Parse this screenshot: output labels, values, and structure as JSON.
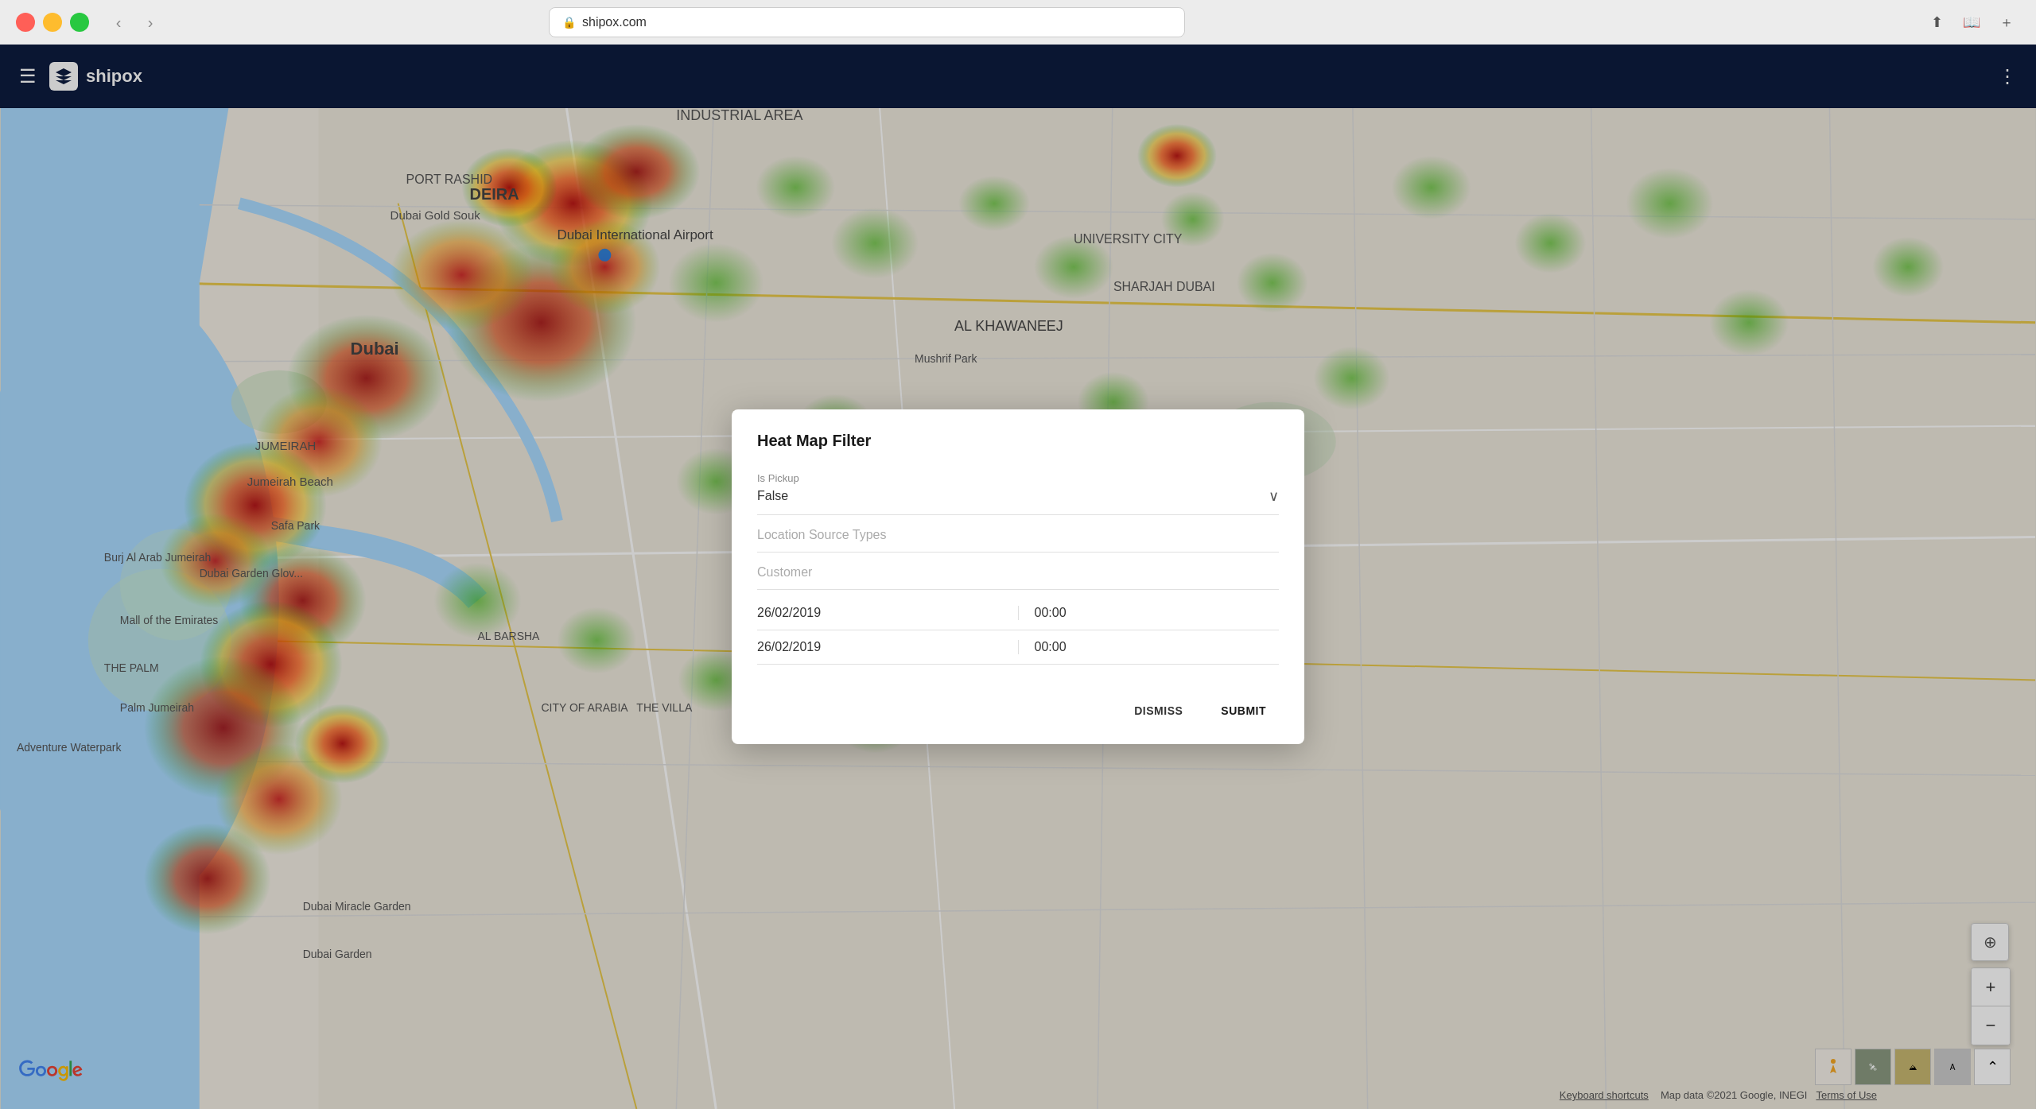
{
  "browser": {
    "url": "shipox.com",
    "back_label": "‹",
    "forward_label": "›"
  },
  "app": {
    "name": "shipox",
    "logo_alt": "Shipox logo"
  },
  "modal": {
    "title": "Heat Map Filter",
    "fields": {
      "is_pickup": {
        "label": "Is Pickup",
        "value": "False"
      },
      "location_source_types": {
        "placeholder": "Location Source Types"
      },
      "customer": {
        "placeholder": "Customer"
      },
      "date_from": {
        "date": "26/02/2019",
        "time": "00:00"
      },
      "date_to": {
        "date": "26/02/2019",
        "time": "00:00"
      }
    },
    "buttons": {
      "dismiss": "DISMISS",
      "submit": "SUBMIT"
    }
  },
  "map": {
    "attribution": "Map data ©2021 Google, INEGI",
    "terms": "Terms of Use",
    "keyboard_shortcuts": "Keyboard shortcuts"
  }
}
